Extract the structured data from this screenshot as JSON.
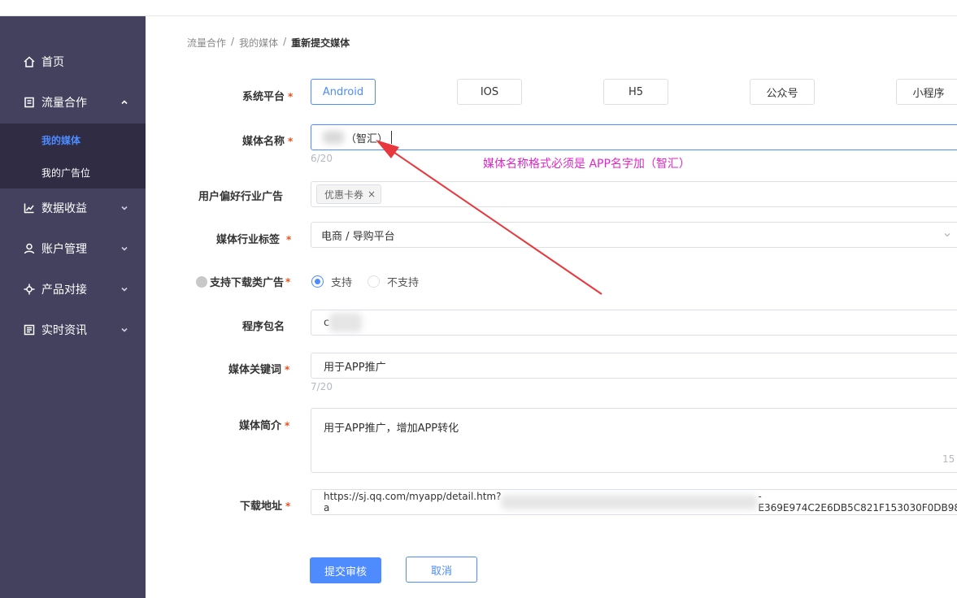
{
  "sidebar": {
    "items": [
      {
        "label": "首页",
        "icon": "home-icon"
      },
      {
        "label": "流量合作",
        "icon": "document-icon"
      },
      {
        "label": "数据收益",
        "icon": "chart-icon"
      },
      {
        "label": "账户管理",
        "icon": "user-icon"
      },
      {
        "label": "产品对接",
        "icon": "plug-icon"
      },
      {
        "label": "实时资讯",
        "icon": "news-icon"
      }
    ],
    "sub_items": [
      {
        "label": "我的媒体"
      },
      {
        "label": "我的广告位"
      }
    ]
  },
  "breadcrumb": {
    "items": [
      "流量合作",
      "我的媒体"
    ],
    "current": "重新提交媒体",
    "separator": "/"
  },
  "form": {
    "platform": {
      "label": "系统平台",
      "required_mark": "*",
      "options": [
        "Android",
        "IOS",
        "H5",
        "公众号",
        "小程序"
      ],
      "selected": "Android"
    },
    "media_name": {
      "label": "媒体名称",
      "required_mark": "*",
      "value": "（智汇）",
      "counter": "6/20"
    },
    "preferred_ads": {
      "label": "用户偏好行业广告",
      "tags": [
        "优惠卡券"
      ],
      "tag_close": "×"
    },
    "industry_tag": {
      "label": "媒体行业标签",
      "required_mark": "*",
      "value": "电商 / 导购平台"
    },
    "download_ads": {
      "label": "支持下载类广告",
      "required_mark": "*",
      "options": [
        "支持",
        "不支持"
      ],
      "selected": "支持"
    },
    "package_name": {
      "label": "程序包名",
      "value": "c"
    },
    "keywords": {
      "label": "媒体关键词",
      "required_mark": "*",
      "value": "用于APP推广",
      "counter": "7/20"
    },
    "intro": {
      "label": "媒体简介",
      "required_mark": "*",
      "value": "用于APP推广，增加APP转化",
      "counter": "15"
    },
    "download_url": {
      "label": "下载地址",
      "required_mark": "*",
      "value_prefix": "https://sj.qq.com/myapp/detail.htm?a",
      "value_suffix": "-E369E974C2E6DB5C821F153030F0DB98"
    },
    "submit_label": "提交审核",
    "cancel_label": "取消"
  },
  "annotation": {
    "text": "媒体名称格式必须是 APP名字加（智汇）",
    "color": "#e026c8",
    "arrow_color": "#e8383d"
  },
  "colors": {
    "sidebar_bg": "#44415e",
    "sidebar_sub_bg": "#2f2c44",
    "accent": "#4d8bff",
    "required": "#e8501b"
  }
}
